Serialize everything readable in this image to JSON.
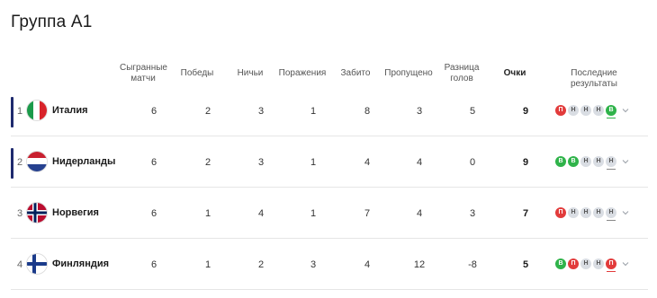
{
  "title": "Группа А1",
  "columns": {
    "played": "Сыгранные матчи",
    "wins": "Победы",
    "draws": "Ничьи",
    "losses": "Поражения",
    "scored": "Забито",
    "conceded": "Пропущено",
    "diff": "Разница голов",
    "points": "Очки",
    "form": "Последние результаты"
  },
  "rows": [
    {
      "pos": "1",
      "team": "Италия",
      "flag": "italy-flag",
      "played": "6",
      "wins": "2",
      "draws": "3",
      "losses": "1",
      "scored": "8",
      "conceded": "3",
      "diff": "5",
      "points": "9",
      "form": [
        "П",
        "Н",
        "Н",
        "Н",
        "В"
      ],
      "form_types": [
        "l",
        "d",
        "d",
        "d",
        "w"
      ]
    },
    {
      "pos": "2",
      "team": "Нидерланды",
      "flag": "netherlands-flag",
      "played": "6",
      "wins": "2",
      "draws": "3",
      "losses": "1",
      "scored": "4",
      "conceded": "4",
      "diff": "0",
      "points": "9",
      "form": [
        "В",
        "В",
        "Н",
        "Н",
        "Н"
      ],
      "form_types": [
        "w",
        "w",
        "d",
        "d",
        "d"
      ]
    },
    {
      "pos": "3",
      "team": "Норвегия",
      "flag": "norway-flag",
      "played": "6",
      "wins": "1",
      "draws": "4",
      "losses": "1",
      "scored": "7",
      "conceded": "4",
      "diff": "3",
      "points": "7",
      "form": [
        "П",
        "Н",
        "Н",
        "Н",
        "Н"
      ],
      "form_types": [
        "l",
        "d",
        "d",
        "d",
        "d"
      ]
    },
    {
      "pos": "4",
      "team": "Финляндия",
      "flag": "finland-flag",
      "played": "6",
      "wins": "1",
      "draws": "2",
      "losses": "3",
      "scored": "4",
      "conceded": "12",
      "diff": "-8",
      "points": "5",
      "form": [
        "В",
        "П",
        "Н",
        "Н",
        "П"
      ],
      "form_types": [
        "w",
        "l",
        "d",
        "d",
        "l"
      ]
    }
  ],
  "colors": {
    "win": "#2fb34a",
    "loss": "#e23b3b",
    "draw": "#d9dde3",
    "accent": "#1e2a6e"
  }
}
